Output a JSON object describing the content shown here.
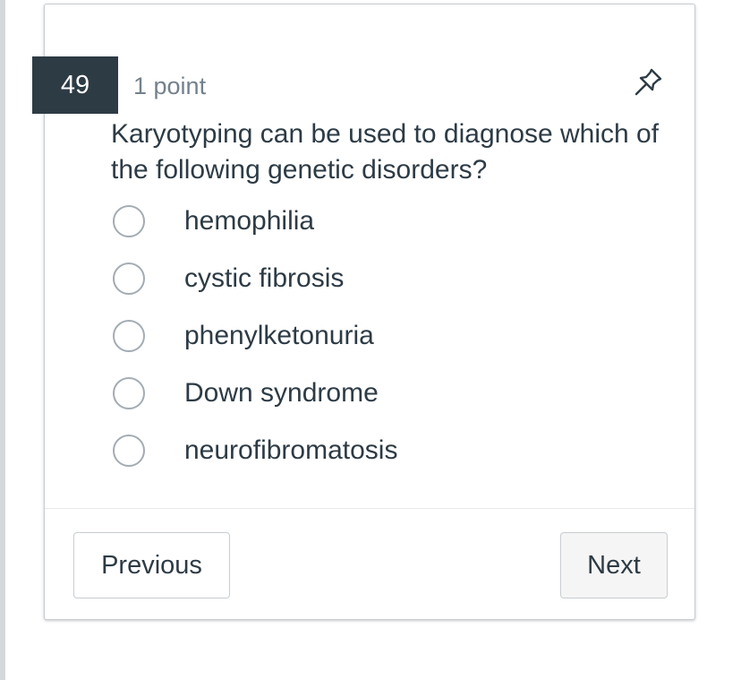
{
  "question": {
    "number": "49",
    "points": "1 point",
    "pin_icon": "pin-icon",
    "text": "Karyotyping can be used to diagnose which of the following genetic disorders?",
    "answers": [
      {
        "label": "hemophilia",
        "selected": false
      },
      {
        "label": "cystic fibrosis",
        "selected": false
      },
      {
        "label": "phenylketonuria",
        "selected": false
      },
      {
        "label": "Down syndrome",
        "selected": false
      },
      {
        "label": "neurofibromatosis",
        "selected": false
      }
    ]
  },
  "navigation": {
    "previous_label": "Previous",
    "next_label": "Next"
  },
  "colors": {
    "question_badge": "#2d3b45",
    "text": "#2d3b45",
    "muted": "#73818c",
    "border": "#c7cdd1"
  }
}
